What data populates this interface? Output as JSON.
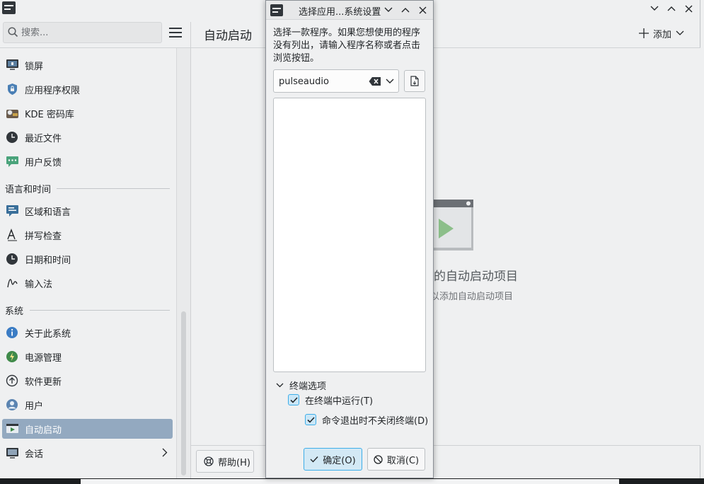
{
  "main_window": {
    "page_title": "自动启动",
    "search_placeholder": "搜索...",
    "add_label": "添加",
    "help_label": "帮助(H)"
  },
  "sidebar": {
    "items_top": [
      {
        "label": "锁屏",
        "icon": "monitor-lock-icon"
      },
      {
        "label": "应用程序权限",
        "icon": "shield-lock-icon"
      },
      {
        "label": "KDE 密码库",
        "icon": "wallet-icon"
      },
      {
        "label": "最近文件",
        "icon": "clock-icon"
      },
      {
        "label": "用户反馈",
        "icon": "feedback-icon"
      }
    ],
    "section_language": "语言和时间",
    "items_language": [
      {
        "label": "区域和语言",
        "icon": "region-icon"
      },
      {
        "label": "拼写检查",
        "icon": "spellcheck-icon"
      },
      {
        "label": "日期和时间",
        "icon": "clock-icon"
      },
      {
        "label": "输入法",
        "icon": "input-method-icon"
      }
    ],
    "section_system": "系统",
    "items_system": [
      {
        "label": "关于此系统",
        "icon": "info-icon"
      },
      {
        "label": "电源管理",
        "icon": "power-icon"
      },
      {
        "label": "软件更新",
        "icon": "update-icon"
      },
      {
        "label": "用户",
        "icon": "user-icon"
      },
      {
        "label": "自动启动",
        "icon": "autostart-icon",
        "selected": true
      },
      {
        "label": "会话",
        "icon": "session-icon"
      }
    ]
  },
  "content": {
    "empty_title": "定的自动启动项目",
    "empty_hint": "以添加自动启动项目"
  },
  "dialog": {
    "title": "选择应用...系统设置",
    "instructions": "选择一款程序。如果您想使用的程序没有列出，请输入程序名称或者点击浏览按钮。",
    "app_input_value": "pulseaudio",
    "terminal_section_label": "终端选项",
    "run_in_terminal_label": "在终端中运行(T)",
    "run_in_terminal_checked": true,
    "keep_open_label": "命令退出时不关闭终端(D)",
    "keep_open_checked": true,
    "ok_label": "确定(O)",
    "cancel_label": "取消(C)"
  },
  "colors": {
    "selection": "#93a9c0",
    "accent": "#3daee9",
    "window_bg": "#eff0f1"
  }
}
